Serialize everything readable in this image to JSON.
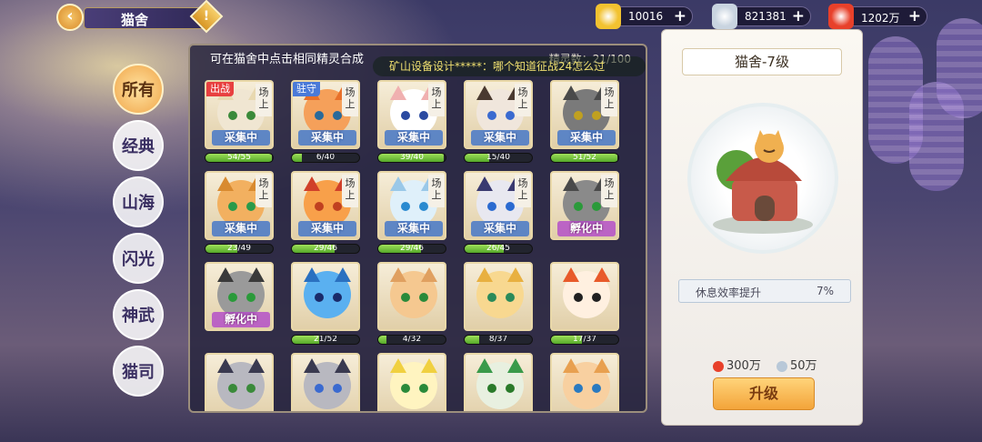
{
  "header": {
    "title": "猫舍",
    "back_icon": "chevron-left-icon",
    "info_icon": "exclamation-icon",
    "currencies": [
      {
        "name": "gold",
        "icon": "gold-ingot-icon",
        "value": "10016",
        "color": "#f2c230"
      },
      {
        "name": "silver",
        "icon": "silver-ingot-icon",
        "value": "821381",
        "color": "#c9d4e0"
      },
      {
        "name": "gem",
        "icon": "red-gem-icon",
        "value": "1202万",
        "color": "#e8402a"
      }
    ]
  },
  "tabs": [
    "所有",
    "经典",
    "山海",
    "闪光",
    "神武",
    "猫司"
  ],
  "panel": {
    "hint": "可在猫舍中点击相同精灵合成",
    "count": "精灵数：21/100",
    "marquee": "矿山设备设计*****：哪个知道征战24怎么过"
  },
  "cards": [
    {
      "tag": "出战",
      "tag_color": "#e84040",
      "side": "场上",
      "state": "采集中",
      "bar": "54/55",
      "pct": 0.98,
      "color": "#f0e6d2",
      "ear": "#e8d8b0",
      "eye": "#3a8a3a"
    },
    {
      "tag": "驻守",
      "tag_color": "#4a7ad8",
      "side": "场上",
      "state": "采集中",
      "bar": "6/40",
      "pct": 0.15,
      "color": "#f5a05a",
      "ear": "#e8702a",
      "eye": "#2a6a9a"
    },
    {
      "tag": "",
      "side": "场上",
      "state": "采集中",
      "bar": "39/40",
      "pct": 0.97,
      "color": "#ffffff",
      "ear": "#f0b0b0",
      "eye": "#2a4aa0"
    },
    {
      "tag": "",
      "side": "场上",
      "state": "采集中",
      "bar": "15/40",
      "pct": 0.37,
      "color": "#f0e6dc",
      "ear": "#4a3a30",
      "eye": "#3a6ad0"
    },
    {
      "tag": "",
      "side": "场上",
      "state": "采集中",
      "bar": "51/52",
      "pct": 0.98,
      "color": "#7a7a7a",
      "ear": "#4a4a4a",
      "eye": "#c0a020"
    },
    {
      "tag": "",
      "side": "场上",
      "state": "采集中",
      "bar": "23/49",
      "pct": 0.47,
      "color": "#f2b060",
      "ear": "#d88a30",
      "eye": "#2a9a4a"
    },
    {
      "tag": "",
      "side": "场上",
      "state": "采集中",
      "bar": "29/46",
      "pct": 0.63,
      "color": "#f8a04a",
      "ear": "#d0402a",
      "eye": "#c04020"
    },
    {
      "tag": "",
      "side": "场上",
      "state": "采集中",
      "bar": "29/46",
      "pct": 0.63,
      "color": "#dff0fa",
      "ear": "#9ac8e8",
      "eye": "#2a8ad0"
    },
    {
      "tag": "",
      "side": "场上",
      "state": "采集中",
      "bar": "26/45",
      "pct": 0.58,
      "color": "#e8e8f0",
      "ear": "#3a3a70",
      "eye": "#2a6ad0"
    },
    {
      "tag": "",
      "side": "场上",
      "state": "孵化中",
      "state_type": "hatch",
      "bar": "",
      "pct": 0,
      "color": "#8a8a8a",
      "ear": "#4a4a4a",
      "eye": "#2a9a3a"
    },
    {
      "tag": "",
      "side": "",
      "state": "孵化中",
      "state_type": "hatch",
      "bar": "",
      "pct": 0,
      "color": "#9a9a9a",
      "ear": "#3a3a3a",
      "eye": "#2a9a3a"
    },
    {
      "tag": "",
      "side": "",
      "state": "",
      "bar": "21/52",
      "pct": 0.4,
      "color": "#5ab0f0",
      "ear": "#2a70c0",
      "eye": "#1a2a6a"
    },
    {
      "tag": "",
      "side": "",
      "state": "",
      "bar": "4/32",
      "pct": 0.12,
      "color": "#f5c890",
      "ear": "#e0a060",
      "eye": "#2a8a3a"
    },
    {
      "tag": "",
      "side": "",
      "state": "",
      "bar": "8/37",
      "pct": 0.22,
      "color": "#f8d890",
      "ear": "#e8b040",
      "eye": "#2a8a5a"
    },
    {
      "tag": "",
      "side": "",
      "state": "",
      "bar": "17/37",
      "pct": 0.46,
      "color": "#fff0e0",
      "ear": "#e85a2a",
      "eye": "#202020"
    },
    {
      "tag": "",
      "side": "",
      "state": "",
      "bar": "",
      "pct": 0,
      "color": "#b8b8c0",
      "ear": "#3a3a50",
      "eye": "#3a8a3a"
    },
    {
      "tag": "",
      "side": "",
      "state": "",
      "bar": "",
      "pct": 0,
      "color": "#b8b8c0",
      "ear": "#3a3a50",
      "eye": "#3a6ad0"
    },
    {
      "tag": "",
      "side": "",
      "state": "",
      "bar": "",
      "pct": 0,
      "color": "#fff4c0",
      "ear": "#f0d040",
      "eye": "#2a8a3a"
    },
    {
      "tag": "",
      "side": "",
      "state": "",
      "bar": "",
      "pct": 0,
      "color": "#e8f0e0",
      "ear": "#3a9a4a",
      "eye": "#2a7a2a"
    },
    {
      "tag": "",
      "side": "",
      "state": "",
      "bar": "",
      "pct": 0,
      "color": "#f8d0a0",
      "ear": "#e8a050",
      "eye": "#2a7ac0"
    }
  ],
  "detail": {
    "title": "猫舍-7级",
    "image": "cat-house-icon",
    "stat_label": "休息效率提升",
    "stat_value": "7%",
    "costs": [
      {
        "icon": "red-gem-icon",
        "value": "300万",
        "color": "#e8402a"
      },
      {
        "icon": "silver-ingot-icon",
        "value": "50万",
        "color": "#b8c8d8"
      }
    ],
    "upgrade_label": "升级"
  }
}
